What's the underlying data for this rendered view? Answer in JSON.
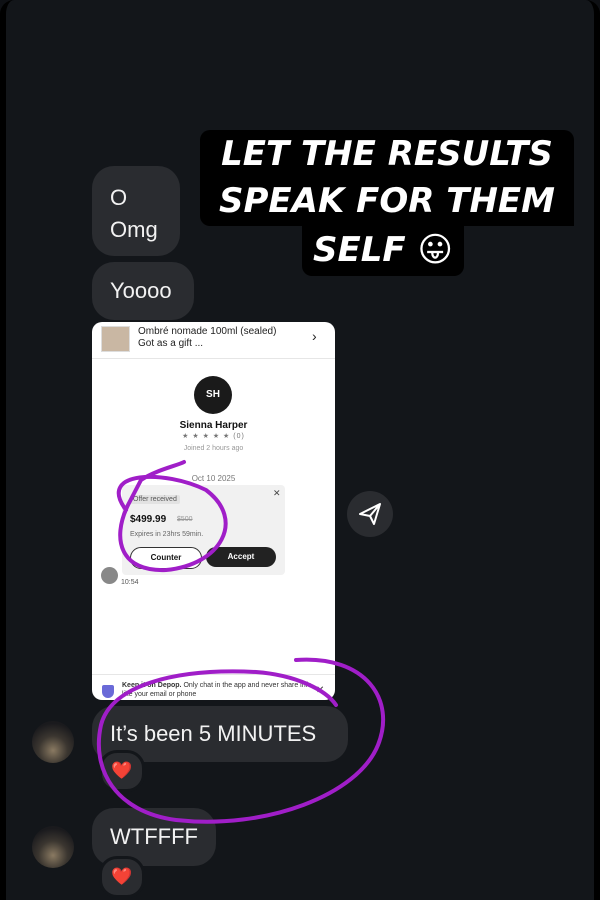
{
  "caption": {
    "line1": "LET THE RESULTS",
    "line2": "SPEAK FOR THEM",
    "line3": "SELF 😛"
  },
  "messages": [
    {
      "text": "O\nOmg"
    },
    {
      "text": "Yoooo"
    },
    {
      "text": "It’s been 5 MINUTES",
      "reaction": "❤️"
    },
    {
      "text": "WTFFFF",
      "reaction": "❤️"
    }
  ],
  "screenshot": {
    "product_title_line1": "Ombré nomade 100ml (sealed)",
    "product_title_line2": "Got as a gift ...",
    "seller_initials": "SH",
    "seller_name": "Sienna Harper",
    "rating": "★ ★ ★ ★ ★  (0)",
    "joined": "Joined 2 hours ago",
    "date": "Oct 10 2025",
    "offer_label": "Offer received",
    "offer_price": "$499.99",
    "original_price": "$500",
    "expires": "Expires in 23hrs 59min.",
    "counter_label": "Counter",
    "accept_label": "Accept",
    "time": "10:54",
    "notice_bold": "Keep it on Depop.",
    "notice_text": " Only chat in the app and never share info like your email or phone"
  },
  "icons": {
    "share": "paper-plane-icon",
    "close": "close-icon",
    "chevron": "chevron-right-icon",
    "shield": "shield-icon"
  },
  "colors": {
    "background": "#13161a",
    "bubble": "#2a2c30",
    "annotation": "#a01ec8"
  }
}
